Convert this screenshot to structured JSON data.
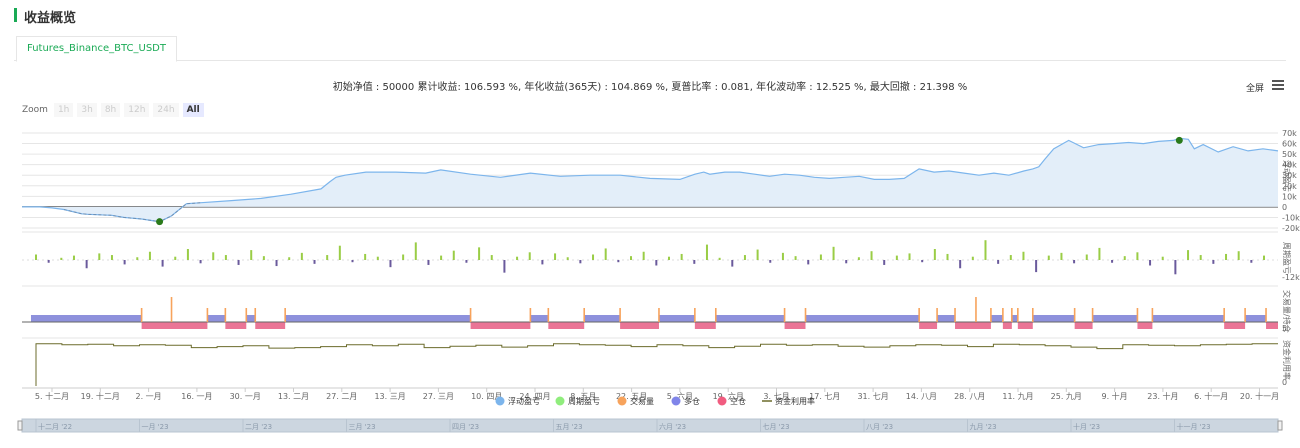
{
  "section": {
    "title": "收益概览"
  },
  "tabs": [
    {
      "label": "Futures_Binance_BTC_USDT"
    }
  ],
  "summary": "初始净值 : 50000 累计收益: 106.593 %, 年化收益(365天) : 104.869 %, 夏普比率 : 0.081, 年化波动率 : 12.525 %, 最大回撤 : 21.398 %",
  "toolbar": {
    "fullscreen_label": "全屏",
    "menu_icon": "hamburger-menu-icon"
  },
  "zoom": {
    "label": "Zoom",
    "buttons": [
      "1h",
      "3h",
      "8h",
      "12h",
      "24h",
      "All"
    ],
    "active": "All"
  },
  "colors": {
    "equity_line": "#7cb5ec",
    "equity_fill": "#e3eef9",
    "drawdown_dash": "#6d8fb3",
    "marker": "#2a7a1a",
    "pnl_pos": "#9acd46",
    "pnl_neg": "#6a5a9c",
    "long": "#8e91dc",
    "short": "#ea7596",
    "trade_vol": "#f7a35c",
    "util_line": "#6b6b2b",
    "navigator": "#ccd6e0"
  },
  "chart_data": [
    {
      "type": "area",
      "ylabel": "浮动盈亏",
      "yticks": [
        "70k",
        "60k",
        "50k",
        "40k",
        "30k",
        "20k",
        "10k",
        "0",
        "-10k",
        "-20k"
      ],
      "ylim": [
        -20000,
        70000
      ],
      "x": [
        0,
        6,
        10,
        14,
        20,
        22,
        30,
        34,
        40,
        46,
        50,
        55,
        60,
        70,
        80,
        90,
        100,
        103,
        105,
        108,
        115,
        125,
        135,
        140,
        150,
        160,
        170,
        180,
        190,
        200,
        210,
        220,
        225,
        228,
        230,
        235,
        240,
        245,
        250,
        255,
        260,
        265,
        270,
        275,
        280,
        285,
        290,
        295,
        300,
        305,
        310,
        315,
        320,
        325,
        330,
        335,
        338,
        340,
        342,
        345,
        350,
        355,
        360,
        365,
        370,
        375,
        380,
        385,
        387,
        390,
        392,
        395,
        400,
        405,
        410,
        415,
        420
      ],
      "values": [
        0,
        0,
        -1000,
        -2500,
        -6500,
        -7000,
        -8000,
        -10000,
        -11500,
        -14000,
        -8500,
        3000,
        4000,
        6000,
        8000,
        12000,
        17000,
        24000,
        28000,
        30000,
        33000,
        33000,
        32000,
        35000,
        31000,
        28000,
        32000,
        29000,
        30000,
        30000,
        27000,
        26000,
        31000,
        33000,
        31000,
        33000,
        33000,
        31000,
        29000,
        31000,
        30000,
        28000,
        27000,
        28000,
        29000,
        26000,
        26000,
        27000,
        36000,
        33000,
        34000,
        32000,
        30000,
        32000,
        30000,
        34000,
        36000,
        38000,
        45000,
        55000,
        63000,
        56000,
        59000,
        60000,
        61000,
        60000,
        62000,
        63000,
        65000,
        64000,
        55000,
        59000,
        52000,
        57000,
        53000,
        55000,
        53000
      ],
      "marker_min": {
        "x": 46,
        "y": -14000
      },
      "marker_max": {
        "x": 387,
        "y": 63000
      },
      "drawdown_range": [
        14,
        62
      ]
    },
    {
      "type": "bar",
      "ylabel": "周期盈亏",
      "yticks": [
        "-12k"
      ],
      "note": "Per-period profit / loss bars",
      "ylim": [
        -12000,
        12000
      ],
      "values": [
        1000,
        -500,
        400,
        800,
        -1500,
        1200,
        900,
        -800,
        500,
        1500,
        -1200,
        600,
        2000,
        -600,
        1400,
        900,
        -900,
        1800,
        700,
        -1100,
        500,
        1300,
        -700,
        900,
        2600,
        -400,
        1100,
        600,
        -1300,
        1000,
        3200,
        -900,
        800,
        1700,
        -500,
        2300,
        900,
        -2300,
        600,
        1400,
        -800,
        1200,
        500,
        -600,
        1000,
        2100,
        -400,
        700,
        1500,
        -1000,
        600,
        1100,
        -700,
        2800,
        400,
        -1200,
        900,
        1900,
        -500,
        1300,
        700,
        -800,
        1000,
        2400,
        -600,
        500,
        1600,
        -900,
        800,
        1200,
        -400,
        2000,
        1100,
        -1500,
        600,
        3600,
        -700,
        900,
        1500,
        -2200,
        800,
        1300,
        -600,
        1000,
        2200,
        -500,
        700,
        1400,
        -1000,
        600,
        -2600,
        1800,
        900,
        -700,
        1100,
        1600,
        -500,
        800
      ]
    },
    {
      "type": "bar",
      "ylabel": "交易量/持仓",
      "yticks": [
        "5"
      ],
      "note": "Position state segments: 1 = long, -1 = short; spikes = trade volume",
      "positions": [
        [
          3,
          40,
          1
        ],
        [
          40,
          62,
          -1
        ],
        [
          62,
          68,
          1
        ],
        [
          68,
          75,
          -1
        ],
        [
          75,
          78,
          1
        ],
        [
          78,
          88,
          -1
        ],
        [
          88,
          150,
          1
        ],
        [
          150,
          170,
          -1
        ],
        [
          170,
          176,
          1
        ],
        [
          176,
          188,
          -1
        ],
        [
          188,
          200,
          1
        ],
        [
          200,
          213,
          -1
        ],
        [
          213,
          225,
          1
        ],
        [
          225,
          232,
          -1
        ],
        [
          232,
          255,
          1
        ],
        [
          255,
          262,
          -1
        ],
        [
          262,
          300,
          1
        ],
        [
          300,
          306,
          -1
        ],
        [
          306,
          312,
          1
        ],
        [
          312,
          324,
          -1
        ],
        [
          324,
          328,
          1
        ],
        [
          328,
          331,
          -1
        ],
        [
          331,
          333,
          1
        ],
        [
          333,
          338,
          -1
        ],
        [
          338,
          352,
          1
        ],
        [
          352,
          358,
          -1
        ],
        [
          358,
          373,
          1
        ],
        [
          373,
          378,
          -1
        ],
        [
          378,
          402,
          1
        ],
        [
          402,
          409,
          -1
        ],
        [
          409,
          416,
          1
        ],
        [
          416,
          420,
          -1
        ]
      ],
      "trade_volume_x": [
        40,
        62,
        68,
        75,
        78,
        88,
        150,
        170,
        176,
        188,
        200,
        213,
        225,
        232,
        255,
        262,
        300,
        306,
        312,
        324,
        328,
        331,
        333,
        338,
        352,
        358,
        373,
        378,
        402,
        409,
        416
      ],
      "trade_volume_big_x": [
        50,
        319
      ]
    },
    {
      "type": "line",
      "ylabel": "资金利用率",
      "yticks": [
        "0"
      ],
      "note": "Capital utilization step line",
      "values": [
        0.88,
        0.86,
        0.87,
        0.84,
        0.86,
        0.85,
        0.8,
        0.82,
        0.84,
        0.79,
        0.8,
        0.82,
        0.86,
        0.84,
        0.87,
        0.8,
        0.83,
        0.85,
        0.81,
        0.84,
        0.88,
        0.86,
        0.85,
        0.82,
        0.86,
        0.84,
        0.8,
        0.83,
        0.87,
        0.85,
        0.86,
        0.83,
        0.81,
        0.84,
        0.86,
        0.85,
        0.82,
        0.87,
        0.86,
        0.84,
        0.81,
        0.78,
        0.86,
        0.85,
        0.84,
        0.86,
        0.87,
        0.88
      ]
    }
  ],
  "x_axis": {
    "ticks": [
      "5. 十二月",
      "19. 十二月",
      "2. 一月",
      "16. 一月",
      "30. 一月",
      "13. 二月",
      "27. 二月",
      "13. 三月",
      "27. 三月",
      "10. 四月",
      "24. 四月",
      "8. 五月",
      "22. 五月",
      "5. 六月",
      "19. 六月",
      "3. 七月",
      "17. 七月",
      "31. 七月",
      "14. 八月",
      "28. 八月",
      "11. 九月",
      "25. 九月",
      "9. 十月",
      "23. 十月",
      "6. 十一月",
      "20. 十一月"
    ]
  },
  "legend": [
    {
      "label": "浮动盈亏",
      "color": "#7cb5ec",
      "shape": "dot"
    },
    {
      "label": "周期盈亏",
      "color": "#90ed7d",
      "shape": "dot"
    },
    {
      "label": "交易量",
      "color": "#f7a35c",
      "shape": "dot"
    },
    {
      "label": "多仓",
      "color": "#8085e9",
      "shape": "dot"
    },
    {
      "label": "空仓",
      "color": "#f15c80",
      "shape": "dot"
    },
    {
      "label": "资金利用率",
      "color": "#6b6b2b",
      "shape": "line"
    }
  ],
  "navigator": {
    "labels": [
      "十二月 '22",
      "一月 '23",
      "二月 '23",
      "三月 '23",
      "四月 '23",
      "五月 '23",
      "六月 '23",
      "七月 '23",
      "八月 '23",
      "九月 '23",
      "十月 '23",
      "十一月 '23"
    ]
  }
}
